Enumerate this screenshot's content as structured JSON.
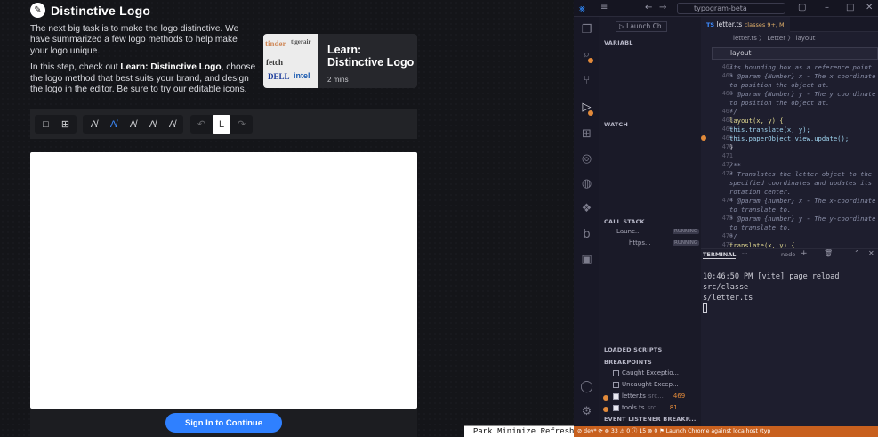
{
  "app": {
    "title": "Distinctive Logo",
    "intro_1": "The next big task is to make the logo distinctive. We have summarized a few logo methods to help make your logo unique.",
    "intro_2_pre": "In this step, check out ",
    "intro_2_bold": "Learn: Distinctive Logo",
    "intro_2_post": ", choose the logo method that best suits your brand, and design the logo in the editor. Be sure to try our editable icons.",
    "learn_card": {
      "title_line1": "Learn:",
      "title_line2": "Distinctive Logo",
      "duration": "2 mins",
      "thumb_logos": [
        "tinder",
        "tigerair",
        "fetch",
        "DELL",
        "intel"
      ]
    },
    "signin_label": "Sign In to Continue",
    "taskbar_text": "Park Minimize Refresh"
  },
  "vscode": {
    "search_text": "typogram-beta",
    "run_config": "Launch Ch",
    "sections": {
      "variables": "VARIABL",
      "watch": "WATCH",
      "call_stack": "CALL STACK",
      "loaded_scripts": "LOADED SCRIPTS",
      "breakpoints": "BREAKPOINTS",
      "event_listener": "EVENT LISTENER BREAKP..."
    },
    "call_stack": [
      {
        "label": "Launc...",
        "status": "RUNNING"
      },
      {
        "label": "https...",
        "status": "RUNNING"
      }
    ],
    "breakpoints": [
      {
        "label": "Caught Exceptio...",
        "checked": false,
        "line": ""
      },
      {
        "label": "Uncaught Excep...",
        "checked": false,
        "line": ""
      },
      {
        "label": "letter.ts",
        "checked": true,
        "dir": "src...",
        "line": "469"
      },
      {
        "label": "tools.ts",
        "checked": true,
        "dir": "src",
        "line": "81"
      }
    ],
    "tab": {
      "lang": "TS",
      "name": "letter.ts",
      "info": "classes 9+, M"
    },
    "breadcrumb": "letter.ts  〉 Letter  〉 layout",
    "find_text": "layout",
    "code": [
      {
        "n": "462",
        "t": "   its bounding box as a reference point."
      },
      {
        "n": "465",
        "t": " * @param {Number} x - The x coordinate"
      },
      {
        "n": "",
        "t": "   to position the object at."
      },
      {
        "n": "466",
        "t": " * @param {Number} y - The y coordinate"
      },
      {
        "n": "",
        "t": "   to position the object at."
      },
      {
        "n": "467",
        "t": " */"
      },
      {
        "n": "468",
        "t": "layout(x, y) {"
      },
      {
        "n": "469",
        "t": "  this.translate(x, y);"
      },
      {
        "n": "469",
        "t": "  this.paperObject.view.update();"
      },
      {
        "n": "470",
        "t": "}"
      },
      {
        "n": "471",
        "t": ""
      },
      {
        "n": "472",
        "t": "/**"
      },
      {
        "n": "473",
        "t": " * Translates the letter object to the"
      },
      {
        "n": "",
        "t": "   specified coordinates and updates its"
      },
      {
        "n": "",
        "t": "   rotation center."
      },
      {
        "n": "474",
        "t": " * @param {number} x - The x-coordinate"
      },
      {
        "n": "",
        "t": "   to translate to."
      },
      {
        "n": "475",
        "t": " * @param {number} y - The y-coordinate"
      },
      {
        "n": "",
        "t": "   to translate to."
      },
      {
        "n": "476",
        "t": " */"
      },
      {
        "n": "477",
        "t": "translate(x, y) {"
      }
    ],
    "terminal": {
      "tab": "TERMINAL",
      "shell": "node",
      "line1": "10:46:50 PM [vite] page reload src/classe",
      "line2": "s/letter.ts"
    },
    "status": {
      "left": "⊘ dev* ⟳ ⊗ 33 ⚠ 0 ⓘ 15  ⊗ 0  ⚑ Launch Chrome against localhost (typ"
    },
    "accent": "#c8601e"
  }
}
